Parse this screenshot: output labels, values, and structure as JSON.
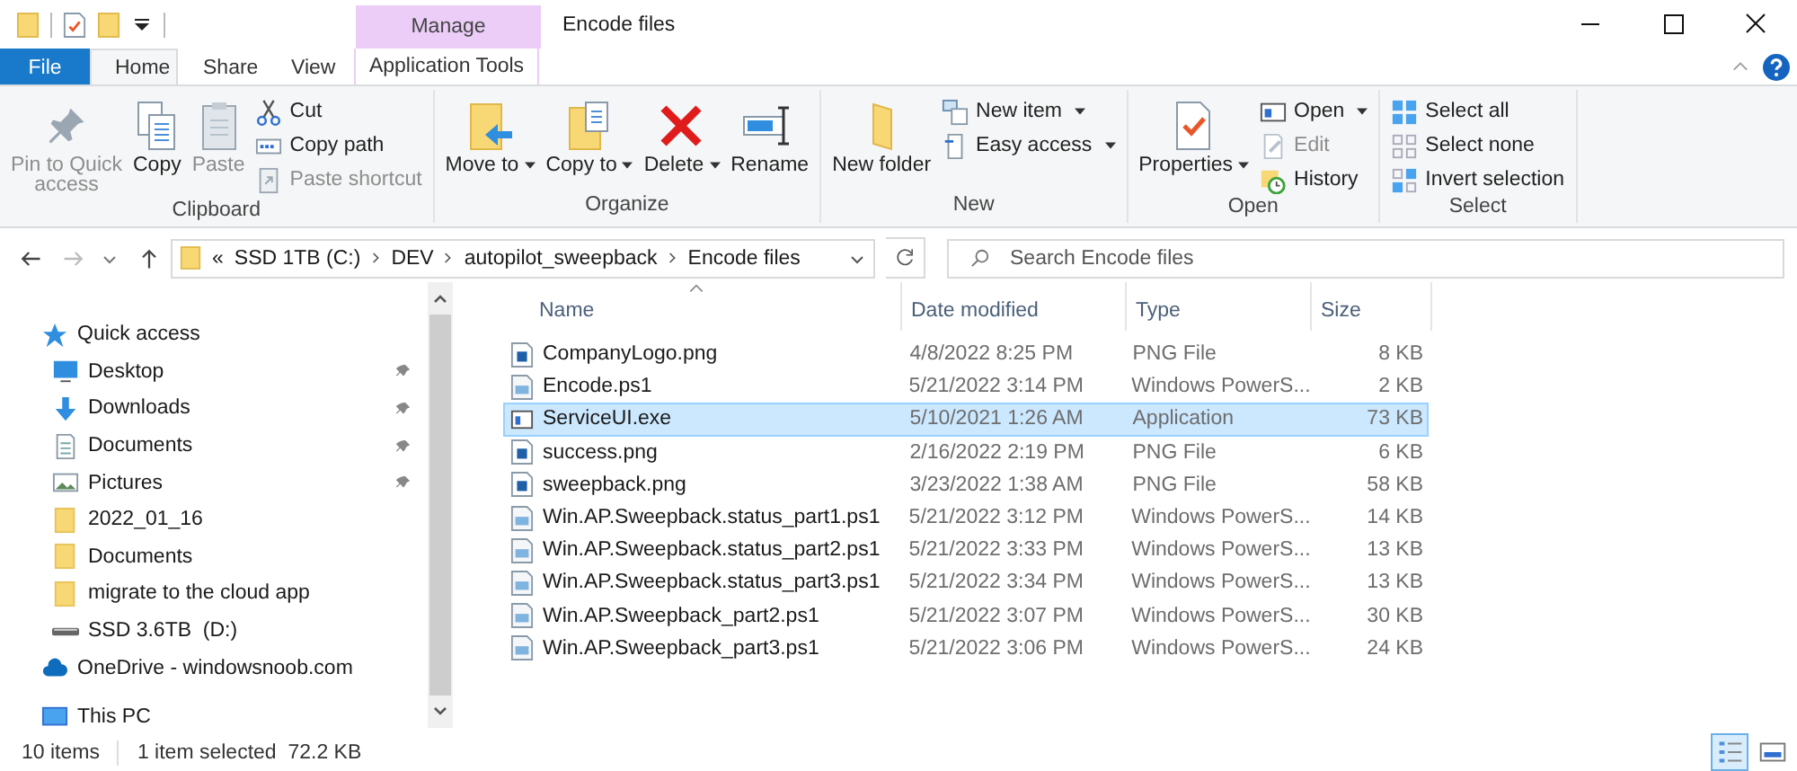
{
  "window": {
    "title": "Encode files"
  },
  "context_tab_group": {
    "label": "Manage"
  },
  "tabs": [
    {
      "label": "File",
      "kind": "file",
      "selected": false
    },
    {
      "label": "Home",
      "kind": "tab",
      "selected": true
    },
    {
      "label": "Share",
      "kind": "tab",
      "selected": false
    },
    {
      "label": "View",
      "kind": "tab",
      "selected": false
    },
    {
      "label": "Application Tools",
      "kind": "contextual",
      "selected": false
    }
  ],
  "ribbon": {
    "groups": [
      {
        "label": "Clipboard",
        "items": [
          {
            "kind": "large",
            "label": "Pin to Quick access",
            "disabled": true,
            "dropdown": false
          },
          {
            "kind": "large",
            "label": "Copy",
            "disabled": false,
            "dropdown": false
          },
          {
            "kind": "large",
            "label": "Paste",
            "disabled": true,
            "dropdown": false
          },
          {
            "kind": "stack",
            "items": [
              {
                "label": "Cut",
                "disabled": false,
                "dropdown": false
              },
              {
                "label": "Copy path",
                "disabled": false,
                "dropdown": false
              },
              {
                "label": "Paste shortcut",
                "disabled": true,
                "dropdown": false
              }
            ]
          }
        ]
      },
      {
        "label": "Organize",
        "items": [
          {
            "kind": "large",
            "label": "Move to",
            "disabled": false,
            "dropdown": true
          },
          {
            "kind": "large",
            "label": "Copy to",
            "disabled": false,
            "dropdown": true
          },
          {
            "kind": "large",
            "label": "Delete",
            "disabled": false,
            "dropdown": true
          },
          {
            "kind": "large",
            "label": "Rename",
            "disabled": false,
            "dropdown": false
          }
        ]
      },
      {
        "label": "New",
        "items": [
          {
            "kind": "large",
            "label": "New folder",
            "disabled": false,
            "dropdown": false
          },
          {
            "kind": "stack",
            "items": [
              {
                "label": "New item",
                "disabled": false,
                "dropdown": true
              },
              {
                "label": "Easy access",
                "disabled": false,
                "dropdown": true
              }
            ]
          }
        ]
      },
      {
        "label": "Open",
        "items": [
          {
            "kind": "large",
            "label": "Properties",
            "disabled": false,
            "dropdown": true
          },
          {
            "kind": "stack",
            "items": [
              {
                "label": "Open",
                "disabled": false,
                "dropdown": true
              },
              {
                "label": "Edit",
                "disabled": true,
                "dropdown": false
              },
              {
                "label": "History",
                "disabled": false,
                "dropdown": false
              }
            ]
          }
        ]
      },
      {
        "label": "Select",
        "items": [
          {
            "kind": "stack",
            "items": [
              {
                "label": "Select all",
                "disabled": false,
                "dropdown": false
              },
              {
                "label": "Select none",
                "disabled": false,
                "dropdown": false
              },
              {
                "label": "Invert selection",
                "disabled": false,
                "dropdown": false
              }
            ]
          }
        ]
      }
    ]
  },
  "address_bar": {
    "overflow": "«",
    "path": [
      "SSD 1TB (C:)",
      "DEV",
      "autopilot_sweepback",
      "Encode files"
    ]
  },
  "search": {
    "placeholder": "Search Encode files"
  },
  "navigation": {
    "items": [
      {
        "label": "Quick access",
        "kind": "quick-access",
        "children": [
          {
            "label": "Desktop",
            "kind": "desktop",
            "pinned": true
          },
          {
            "label": "Downloads",
            "kind": "downloads",
            "pinned": true
          },
          {
            "label": "Documents",
            "kind": "documents",
            "pinned": true
          },
          {
            "label": "Pictures",
            "kind": "pictures",
            "pinned": true
          },
          {
            "label": "2022_01_16",
            "kind": "folder",
            "pinned": false
          },
          {
            "label": "Documents",
            "kind": "folder",
            "pinned": false
          },
          {
            "label": "migrate to the cloud app",
            "kind": "folder",
            "pinned": false
          },
          {
            "label": "SSD 3.6TB  (D:)",
            "kind": "drive",
            "pinned": false
          }
        ]
      },
      {
        "label": "OneDrive - windowsnoob.com",
        "kind": "onedrive"
      },
      {
        "label": "This PC",
        "kind": "pc"
      }
    ]
  },
  "file_list": {
    "columns": [
      {
        "label": "Name",
        "sorted": true
      },
      {
        "label": "Date modified",
        "sorted": false
      },
      {
        "label": "Type",
        "sorted": false
      },
      {
        "label": "Size",
        "sorted": false
      }
    ],
    "rows": [
      {
        "name": "CompanyLogo.png",
        "date": "4/8/2022 8:25 PM",
        "type": "PNG File",
        "size": "8 KB",
        "kind": "image",
        "selected": false
      },
      {
        "name": "Encode.ps1",
        "date": "5/21/2022 3:14 PM",
        "type": "Windows PowerS...",
        "size": "2 KB",
        "kind": "script",
        "selected": false
      },
      {
        "name": "ServiceUI.exe",
        "date": "5/10/2021 1:26 AM",
        "type": "Application",
        "size": "73 KB",
        "kind": "app",
        "selected": true
      },
      {
        "name": "success.png",
        "date": "2/16/2022 2:19 PM",
        "type": "PNG File",
        "size": "6 KB",
        "kind": "image",
        "selected": false
      },
      {
        "name": "sweepback.png",
        "date": "3/23/2022 1:38 AM",
        "type": "PNG File",
        "size": "58 KB",
        "kind": "image",
        "selected": false
      },
      {
        "name": "Win.AP.Sweepback.status_part1.ps1",
        "date": "5/21/2022 3:12 PM",
        "type": "Windows PowerS...",
        "size": "14 KB",
        "kind": "script",
        "selected": false
      },
      {
        "name": "Win.AP.Sweepback.status_part2.ps1",
        "date": "5/21/2022 3:33 PM",
        "type": "Windows PowerS...",
        "size": "13 KB",
        "kind": "script",
        "selected": false
      },
      {
        "name": "Win.AP.Sweepback.status_part3.ps1",
        "date": "5/21/2022 3:34 PM",
        "type": "Windows PowerS...",
        "size": "13 KB",
        "kind": "script",
        "selected": false
      },
      {
        "name": "Win.AP.Sweepback_part2.ps1",
        "date": "5/21/2022 3:07 PM",
        "type": "Windows PowerS...",
        "size": "30 KB",
        "kind": "script",
        "selected": false
      },
      {
        "name": "Win.AP.Sweepback_part3.ps1",
        "date": "5/21/2022 3:06 PM",
        "type": "Windows PowerS...",
        "size": "24 KB",
        "kind": "script",
        "selected": false
      }
    ]
  },
  "status_bar": {
    "item_count": "10 items",
    "selection": "1 item selected  72.2 KB"
  },
  "views": [
    {
      "kind": "details",
      "selected": true
    },
    {
      "kind": "large-icons",
      "selected": false
    }
  ]
}
